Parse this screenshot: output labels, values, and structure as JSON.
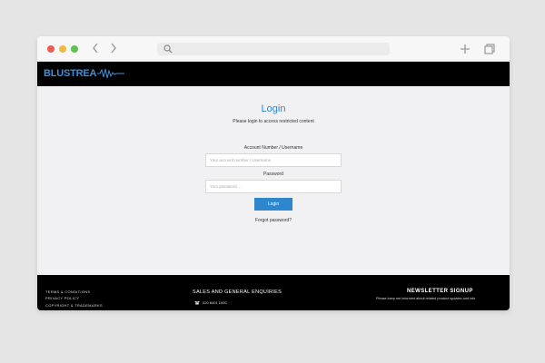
{
  "browser": {
    "icons": [
      "back-icon",
      "forward-icon",
      "search-icon",
      "plus-icon",
      "tabs-icon"
    ]
  },
  "header": {
    "logo_text": "BLUSTREA",
    "logo_color": "#3f8fd9"
  },
  "login": {
    "title": "Login",
    "subtitle": "Please login to access restricted content",
    "account_label": "Account Number / Username",
    "account_placeholder": "Your account number / Username",
    "password_label": "Password",
    "password_placeholder": "Your password ...",
    "button_label": "Login",
    "forgot_label": "Forgot password?",
    "accent_color": "#2e86cf"
  },
  "footer": {
    "links": [
      "TERMS & CONDITIONS",
      "PRIVACY POLICY",
      "COPYRIGHT & TRADEMARKS"
    ],
    "sales_heading": "SALES AND GENERAL ENQUIRIES",
    "phone": "020 8401 1000",
    "newsletter_heading": "NEWSLETTER SIGNUP",
    "newsletter_text": "Please keep me informed about related product updates and info"
  }
}
